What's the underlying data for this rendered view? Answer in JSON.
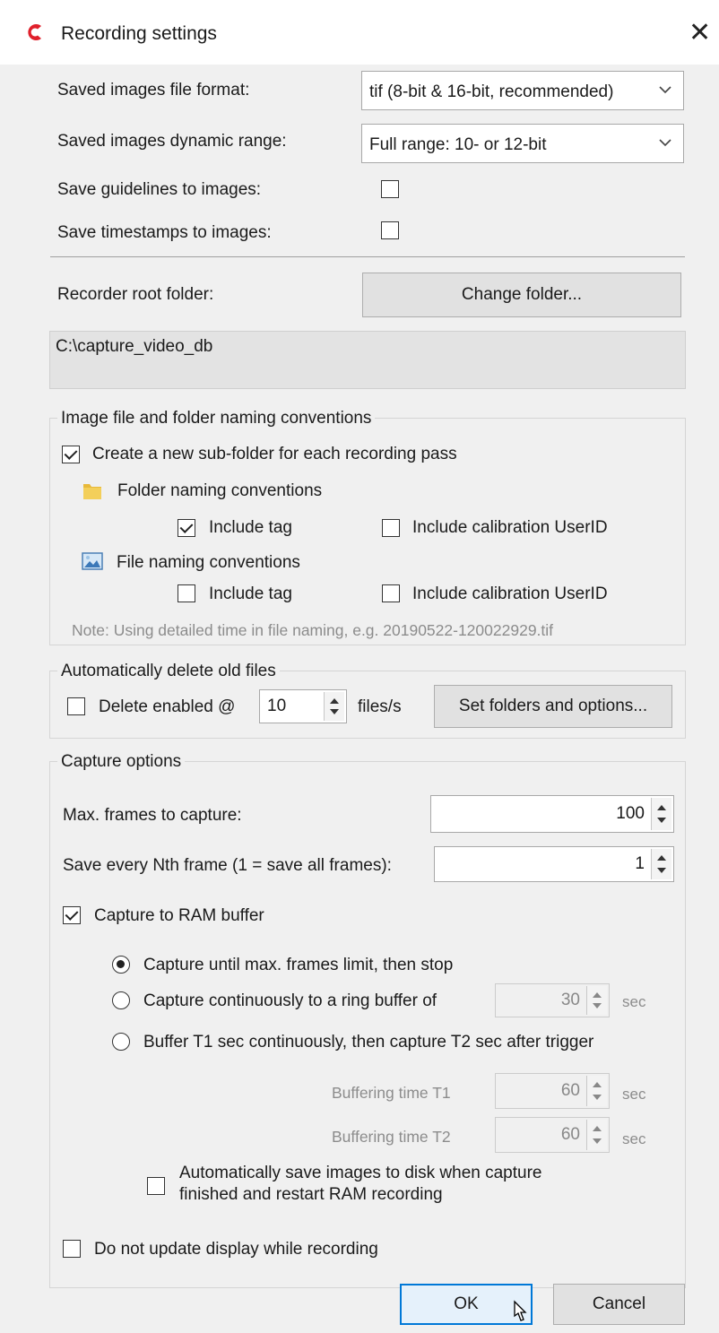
{
  "window": {
    "title": "Recording settings",
    "close_glyph": "✕",
    "app_icon": "app-logo-icon",
    "accent_color": "#e0202b"
  },
  "general": {
    "file_format_label": "Saved images file format:",
    "file_format_value": "tif (8-bit & 16-bit, recommended)",
    "dynamic_range_label": "Saved images dynamic range:",
    "dynamic_range_value": "Full range: 10- or 12-bit",
    "save_guidelines_label": "Save guidelines to images:",
    "save_guidelines_checked": false,
    "save_timestamps_label": "Save timestamps to images:",
    "save_timestamps_checked": false,
    "root_folder_label": "Recorder root folder:",
    "change_folder_button": "Change folder...",
    "root_folder_path": "C:\\capture_video_db"
  },
  "naming": {
    "group_title": "Image file and folder naming conventions",
    "subfolder_label": "Create a new sub-folder for each recording pass",
    "subfolder_checked": true,
    "folder_conventions_label": "Folder naming conventions",
    "folder_icon": "folder-icon",
    "folder_include_tag_label": "Include tag",
    "folder_include_tag_checked": true,
    "folder_include_userid_label": "Include calibration UserID",
    "folder_include_userid_checked": false,
    "file_conventions_label": "File naming conventions",
    "file_icon": "image-file-icon",
    "file_include_tag_label": "Include tag",
    "file_include_tag_checked": false,
    "file_include_userid_label": "Include calibration UserID",
    "file_include_userid_checked": false,
    "note": "Note: Using detailed time in file naming, e.g. 20190522-120022929.tif"
  },
  "delete": {
    "group_title": "Automatically delete old files",
    "enabled_label": "Delete enabled @",
    "enabled_checked": false,
    "rate_value": "10",
    "rate_unit": "files/s",
    "options_button": "Set folders and options..."
  },
  "capture": {
    "group_title": "Capture options",
    "max_frames_label": "Max. frames to capture:",
    "max_frames_value": "100",
    "nth_frame_label": "Save every Nth frame (1 = save all frames):",
    "nth_frame_value": "1",
    "ram_buffer_label": "Capture to RAM buffer",
    "ram_buffer_checked": true,
    "mode_options": [
      {
        "label": "Capture until max. frames limit, then stop",
        "selected": true
      },
      {
        "label": "Capture continuously to a ring buffer of",
        "selected": false
      },
      {
        "label": "Buffer T1 sec continuously, then capture T2 sec after trigger",
        "selected": false
      }
    ],
    "ring_buffer_value": "30",
    "ring_buffer_unit": "sec",
    "t1_label": "Buffering time T1",
    "t1_value": "60",
    "t1_unit": "sec",
    "t2_label": "Buffering time T2",
    "t2_value": "60",
    "t2_unit": "sec",
    "autosave_line1": "Automatically save images to disk when capture",
    "autosave_line2": "finished and restart RAM recording",
    "autosave_checked": false,
    "no_update_label": "Do not update display while recording",
    "no_update_checked": false
  },
  "footer": {
    "ok_label": "OK",
    "cancel_label": "Cancel"
  }
}
